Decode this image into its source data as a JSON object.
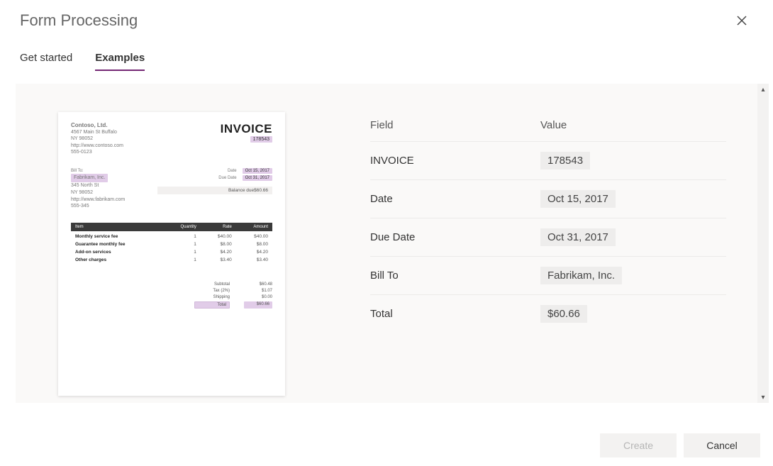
{
  "dialog": {
    "title": "Form Processing"
  },
  "tabs": {
    "getStarted": "Get started",
    "examples": "Examples"
  },
  "invoice": {
    "from": {
      "company": "Contoso, Ltd.",
      "address": "4567 Main St Buffalo",
      "zip": "NY 98052",
      "web": "http://www.contoso.com",
      "phone": "555-0123"
    },
    "title": "INVOICE",
    "number": "178543",
    "billToLabel": "Bill To:",
    "billTo": {
      "company": "Fabrikam, Inc.",
      "address": "345 North St",
      "zip": "NY 98052",
      "web": "http://www.fabrikam.com",
      "phone": "555-345"
    },
    "dateLabel": "Date",
    "date": "Oct 15, 2017",
    "dueDateLabel": "Due Date",
    "dueDate": "Oct 31, 2017",
    "balanceDueLabel": "Balance due",
    "balanceDue": "$60.66",
    "columns": {
      "item": "Item",
      "qty": "Quantity",
      "rate": "Rate",
      "amount": "Amount"
    },
    "lines": [
      {
        "item": "Monthly service fee",
        "qty": "1",
        "rate": "$40.00",
        "amount": "$40.00"
      },
      {
        "item": "Guarantee monthly fee",
        "qty": "1",
        "rate": "$8.00",
        "amount": "$8.00"
      },
      {
        "item": "Add-on services",
        "qty": "1",
        "rate": "$4.20",
        "amount": "$4.20"
      },
      {
        "item": "Other charges",
        "qty": "1",
        "rate": "$3.40",
        "amount": "$3.40"
      }
    ],
    "totals": {
      "subtotalLabel": "Subtotal",
      "subtotal": "$60.48",
      "taxLabel": "Tax (2%)",
      "tax": "$1.07",
      "shippingLabel": "Shipping",
      "shipping": "$0.00",
      "totalLabel": "Total",
      "total": "$60.66"
    }
  },
  "fields": {
    "header": {
      "field": "Field",
      "value": "Value"
    },
    "rows": [
      {
        "field": "INVOICE",
        "value": "178543"
      },
      {
        "field": "Date",
        "value": "Oct 15, 2017"
      },
      {
        "field": "Due Date",
        "value": "Oct 31, 2017"
      },
      {
        "field": "Bill To",
        "value": "Fabrikam, Inc."
      },
      {
        "field": "Total",
        "value": "$60.66"
      }
    ]
  },
  "footer": {
    "create": "Create",
    "cancel": "Cancel"
  }
}
